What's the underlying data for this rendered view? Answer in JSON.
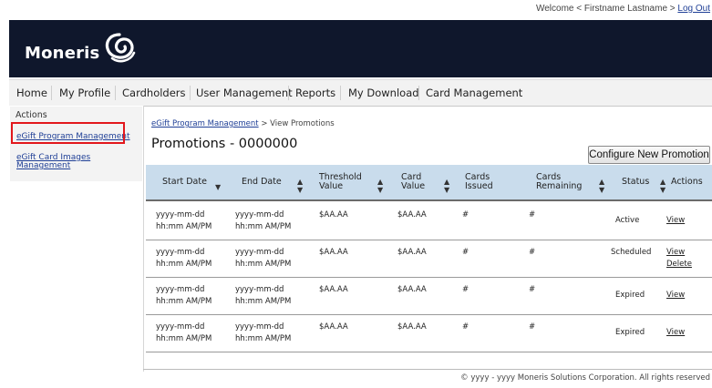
{
  "top": {
    "welcome_text": "Welcome < Firstname Lastname >",
    "logout_label": "Log Out"
  },
  "header": {
    "logo_text": "Moneris"
  },
  "nav": {
    "items": [
      "Home",
      "My Profile",
      "Cardholders",
      "User Management",
      "Reports",
      "My Download",
      "Card Management"
    ]
  },
  "sidebar": {
    "heading": "Actions",
    "link_program": "eGift Program Management",
    "link_images_1": "eGift Card Images",
    "link_images_2": "Management"
  },
  "breadcrumb": {
    "link": "eGift Program Management",
    "current": " > View Promotions"
  },
  "page": {
    "title": "Promotions - 0000000",
    "config_button": "Configure New Promotion"
  },
  "table": {
    "headers": {
      "start_date": "Start Date",
      "end_date": "End Date",
      "threshold_1": "Threshold",
      "threshold_2": "Value",
      "card_1": "Card",
      "card_2": "Value",
      "issued_1": "Cards",
      "issued_2": "Issued",
      "remaining_1": "Cards",
      "remaining_2": "Remaining",
      "status": "Status",
      "actions": "Actions"
    },
    "rows": [
      {
        "start_date": "yyyy-mm-dd",
        "start_time": "hh:mm AM/PM",
        "end_date": "yyyy-mm-dd",
        "end_time": "hh:mm AM/PM",
        "threshold": "$AA.AA",
        "card_value": "$AA.AA",
        "issued": "#",
        "remaining": "#",
        "status": "Active",
        "action1": "View",
        "action2": ""
      },
      {
        "start_date": "yyyy-mm-dd",
        "start_time": "hh:mm AM/PM",
        "end_date": "yyyy-mm-dd",
        "end_time": "hh:mm AM/PM",
        "threshold": "$AA.AA",
        "card_value": "$AA.AA",
        "issued": "#",
        "remaining": "#",
        "status": "Scheduled",
        "action1": "View",
        "action2": "Delete"
      },
      {
        "start_date": "yyyy-mm-dd",
        "start_time": "hh:mm AM/PM",
        "end_date": "yyyy-mm-dd",
        "end_time": "hh:mm AM/PM",
        "threshold": "$AA.AA",
        "card_value": "$AA.AA",
        "issued": "#",
        "remaining": "#",
        "status": "Expired",
        "action1": "View",
        "action2": ""
      },
      {
        "start_date": "yyyy-mm-dd",
        "start_time": "hh:mm AM/PM",
        "end_date": "yyyy-mm-dd",
        "end_time": "hh:mm AM/PM",
        "threshold": "$AA.AA",
        "card_value": "$AA.AA",
        "issued": "#",
        "remaining": "#",
        "status": "Expired",
        "action1": "View",
        "action2": ""
      }
    ]
  },
  "footer": {
    "text": "© yyyy - yyyy  Moneris Solutions Corporation. All rights reserved"
  },
  "colors": {
    "header_bg": "#0f172c",
    "table_header_bg": "#c9dcec",
    "highlight_border": "#e2171c",
    "link": "#1f3f96"
  }
}
